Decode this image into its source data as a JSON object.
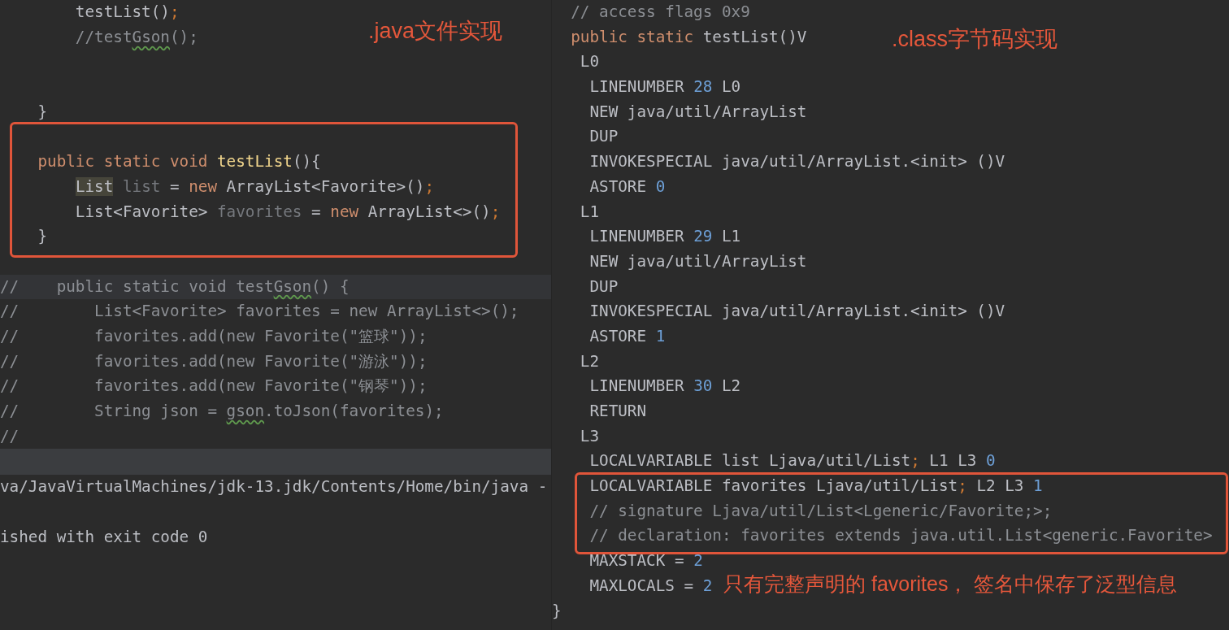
{
  "editor": {
    "note": ".java文件实现",
    "lines": [
      {
        "kind": "code",
        "tokens": [
          {
            "kind": "plain",
            "text": "        testList()"
          },
          {
            "kind": "semi",
            "text": ";"
          }
        ]
      },
      {
        "kind": "code",
        "tokens": [
          {
            "kind": "comment",
            "text": "        //test"
          },
          {
            "kind": "typo",
            "text": "Gson"
          },
          {
            "kind": "comment",
            "text": "();"
          }
        ]
      },
      {
        "kind": "blank"
      },
      {
        "kind": "blank"
      },
      {
        "kind": "code",
        "tokens": [
          {
            "kind": "plain",
            "text": "    }"
          }
        ]
      },
      {
        "kind": "blank"
      },
      {
        "kind": "code",
        "tokens": [
          {
            "kind": "keyword",
            "text": "    public static void "
          },
          {
            "kind": "method",
            "text": "testList"
          },
          {
            "kind": "plain",
            "text": "(){"
          }
        ]
      },
      {
        "kind": "code",
        "tokens": [
          {
            "kind": "highlight",
            "text": "        List"
          },
          {
            "kind": "unused",
            "text": " list"
          },
          {
            "kind": "plain",
            "text": " = "
          },
          {
            "kind": "keyword",
            "text": "new"
          },
          {
            "kind": "plain",
            "text": " ArrayList<Favorite>()"
          },
          {
            "kind": "semi",
            "text": ";"
          }
        ]
      },
      {
        "kind": "code",
        "tokens": [
          {
            "kind": "plain",
            "text": "        List<Favorite> "
          },
          {
            "kind": "unused",
            "text": "favorites"
          },
          {
            "kind": "plain",
            "text": " = "
          },
          {
            "kind": "keyword",
            "text": "new"
          },
          {
            "kind": "plain",
            "text": " ArrayList<>()"
          },
          {
            "kind": "semi",
            "text": ";"
          }
        ]
      },
      {
        "kind": "code",
        "tokens": [
          {
            "kind": "plain",
            "text": "    }"
          }
        ]
      },
      {
        "kind": "blank"
      },
      {
        "kind": "current",
        "tokens": [
          {
            "kind": "comment",
            "text": "//    public static void test"
          },
          {
            "kind": "typo",
            "text": "Gson"
          },
          {
            "kind": "comment",
            "text": "() {"
          }
        ]
      },
      {
        "kind": "code",
        "tokens": [
          {
            "kind": "comment",
            "text": "//        List<Favorite> favorites = new ArrayList<>();"
          }
        ]
      },
      {
        "kind": "code",
        "tokens": [
          {
            "kind": "comment",
            "text": "//        favorites.add(new Favorite(\"篮球\"));"
          }
        ]
      },
      {
        "kind": "code",
        "tokens": [
          {
            "kind": "comment",
            "text": "//        favorites.add(new Favorite(\"游泳\"));"
          }
        ]
      },
      {
        "kind": "code",
        "tokens": [
          {
            "kind": "comment",
            "text": "//        favorites.add(new Favorite(\"钢琴\"));"
          }
        ]
      },
      {
        "kind": "code",
        "tokens": [
          {
            "kind": "comment",
            "text": "//        String json = "
          },
          {
            "kind": "typo",
            "text": "gson"
          },
          {
            "kind": "comment",
            "text": ".toJson(favorites);"
          }
        ]
      },
      {
        "kind": "code",
        "tokens": [
          {
            "kind": "comment",
            "text": "//"
          }
        ]
      }
    ]
  },
  "console": {
    "lines": [
      {
        "kind": "text",
        "text": "va/JavaVirtualMachines/jdk-13.jdk/Contents/Home/bin/java -"
      },
      {
        "kind": "blank"
      },
      {
        "kind": "text",
        "text": "ished with exit code 0"
      }
    ]
  },
  "bytecode": {
    "note": ".class字节码实现",
    "bottom_note": "只有完整声明的 favorites， 签名中保存了泛型信息",
    "lines": [
      {
        "kind": "code",
        "tokens": [
          {
            "kind": "comment",
            "text": "  // access flags 0x9"
          }
        ]
      },
      {
        "kind": "code",
        "tokens": [
          {
            "kind": "keyword",
            "text": "  public static "
          },
          {
            "kind": "plain",
            "text": "testList()V"
          }
        ]
      },
      {
        "kind": "code",
        "tokens": [
          {
            "kind": "plain",
            "text": "   L0"
          }
        ]
      },
      {
        "kind": "code",
        "tokens": [
          {
            "kind": "plain",
            "text": "    LINENUMBER "
          },
          {
            "kind": "number",
            "text": "28"
          },
          {
            "kind": "plain",
            "text": " L0"
          }
        ]
      },
      {
        "kind": "code",
        "tokens": [
          {
            "kind": "plain",
            "text": "    NEW java/util/ArrayList"
          }
        ]
      },
      {
        "kind": "code",
        "tokens": [
          {
            "kind": "plain",
            "text": "    DUP"
          }
        ]
      },
      {
        "kind": "code",
        "tokens": [
          {
            "kind": "plain",
            "text": "    INVOKESPECIAL java/util/ArrayList.<init> ()V"
          }
        ]
      },
      {
        "kind": "code",
        "tokens": [
          {
            "kind": "plain",
            "text": "    ASTORE "
          },
          {
            "kind": "number",
            "text": "0"
          }
        ]
      },
      {
        "kind": "code",
        "tokens": [
          {
            "kind": "plain",
            "text": "   L1"
          }
        ]
      },
      {
        "kind": "code",
        "tokens": [
          {
            "kind": "plain",
            "text": "    LINENUMBER "
          },
          {
            "kind": "number",
            "text": "29"
          },
          {
            "kind": "plain",
            "text": " L1"
          }
        ]
      },
      {
        "kind": "code",
        "tokens": [
          {
            "kind": "plain",
            "text": "    NEW java/util/ArrayList"
          }
        ]
      },
      {
        "kind": "code",
        "tokens": [
          {
            "kind": "plain",
            "text": "    DUP"
          }
        ]
      },
      {
        "kind": "code",
        "tokens": [
          {
            "kind": "plain",
            "text": "    INVOKESPECIAL java/util/ArrayList.<init> ()V"
          }
        ]
      },
      {
        "kind": "code",
        "tokens": [
          {
            "kind": "plain",
            "text": "    ASTORE "
          },
          {
            "kind": "number",
            "text": "1"
          }
        ]
      },
      {
        "kind": "code",
        "tokens": [
          {
            "kind": "plain",
            "text": "   L2"
          }
        ]
      },
      {
        "kind": "code",
        "tokens": [
          {
            "kind": "plain",
            "text": "    LINENUMBER "
          },
          {
            "kind": "number",
            "text": "30"
          },
          {
            "kind": "plain",
            "text": " L2"
          }
        ]
      },
      {
        "kind": "code",
        "tokens": [
          {
            "kind": "plain",
            "text": "    RETURN"
          }
        ]
      },
      {
        "kind": "code",
        "tokens": [
          {
            "kind": "plain",
            "text": "   L3"
          }
        ]
      },
      {
        "kind": "code",
        "tokens": [
          {
            "kind": "plain",
            "text": "    LOCALVARIABLE list Ljava/util/List"
          },
          {
            "kind": "semi",
            "text": ";"
          },
          {
            "kind": "plain",
            "text": " L1 L3 "
          },
          {
            "kind": "number",
            "text": "0"
          }
        ]
      },
      {
        "kind": "code",
        "tokens": [
          {
            "kind": "plain",
            "text": "    LOCALVARIABLE favorites Ljava/util/List"
          },
          {
            "kind": "semi",
            "text": ";"
          },
          {
            "kind": "plain",
            "text": " L2 L3 "
          },
          {
            "kind": "number",
            "text": "1"
          }
        ]
      },
      {
        "kind": "code",
        "tokens": [
          {
            "kind": "comment",
            "text": "    // signature Ljava/util/List<Lgeneric/Favorite;>;"
          }
        ]
      },
      {
        "kind": "code",
        "tokens": [
          {
            "kind": "comment",
            "text": "    // declaration: favorites extends java.util.List<generic.Favorite>"
          }
        ]
      },
      {
        "kind": "code",
        "tokens": [
          {
            "kind": "plain",
            "text": "    MAXSTACK = "
          },
          {
            "kind": "number",
            "text": "2"
          }
        ]
      },
      {
        "kind": "code",
        "tokens": [
          {
            "kind": "plain",
            "text": "    MAXLOCALS = "
          },
          {
            "kind": "number",
            "text": "2"
          }
        ]
      },
      {
        "kind": "code",
        "tokens": [
          {
            "kind": "plain",
            "text": "}"
          }
        ]
      }
    ]
  }
}
